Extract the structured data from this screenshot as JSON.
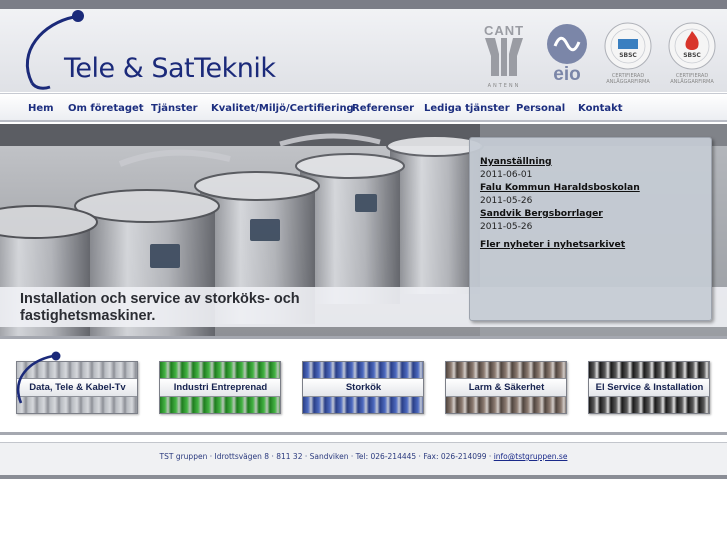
{
  "brand": {
    "name": "Tele & SatTeknik",
    "color": "#1b2a7a"
  },
  "certifications": [
    {
      "name": "CANT",
      "caption": "ANTENN"
    },
    {
      "name": "eio"
    },
    {
      "name": "SBSC",
      "caption": "CERTIFIERAD ANLÄGGARFIRMA"
    },
    {
      "name": "SBSC",
      "caption": "CERTIFIERAD ANLÄGGARFIRMA"
    }
  ],
  "nav": {
    "items": [
      {
        "label": "Hem"
      },
      {
        "label": "Om företaget"
      },
      {
        "label": "Tjänster"
      },
      {
        "label": "Kvalitet/Miljö/Certifiering"
      },
      {
        "label": "Referenser"
      },
      {
        "label": "Lediga tjänster"
      },
      {
        "label": "Personal"
      },
      {
        "label": "Kontakt"
      }
    ]
  },
  "hero": {
    "caption": "Installation och service av storköks- och fastighetsmaskiner."
  },
  "news": {
    "items": [
      {
        "title": "Nyanställning",
        "date": "2011-06-01"
      },
      {
        "title": "Falu Kommun Haraldsboskolan",
        "date": "2011-05-26"
      },
      {
        "title": "Sandvik Bergsborrlager",
        "date": "2011-05-26"
      }
    ],
    "more": "Fler nyheter i nyhetsarkivet"
  },
  "services": [
    {
      "label": "Data, Tele & Kabel-Tv",
      "color": "#8c8f96"
    },
    {
      "label": "Industri Entreprenad",
      "color": "#2e9a2e"
    },
    {
      "label": "Storkök",
      "color": "#2f4a9a"
    },
    {
      "label": "Larm & Säkerhet",
      "color": "#6b5e57"
    },
    {
      "label": "El Service & Installation",
      "color": "#2a2a2a"
    }
  ],
  "footer": {
    "text": "TST gruppen · Idrottsvägen 8 · 811 32 · Sandviken · Tel: 026-214445 · Fax: 026-214099 · ",
    "email": "info@tstgruppen.se"
  }
}
